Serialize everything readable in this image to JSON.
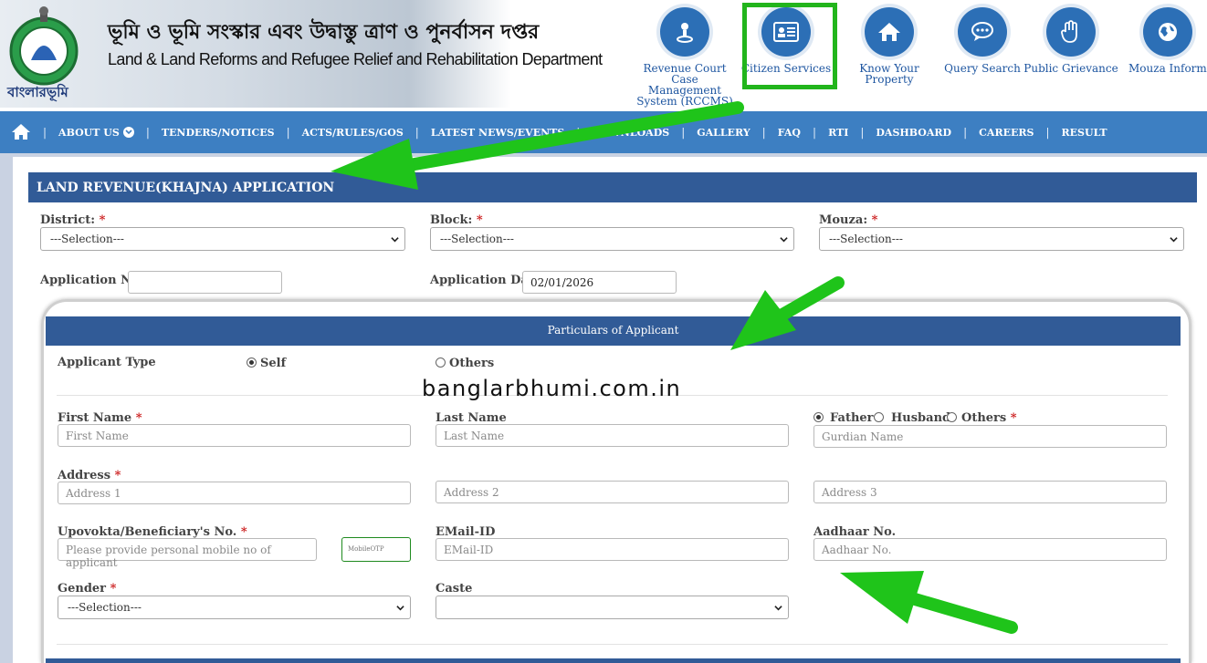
{
  "header": {
    "dept_bengali": "ভূমি ও ভূমি সংস্কার এবং উদ্বাস্তু ত্রাণ ও পুনর্বাসন দপ্তর",
    "dept_english": "Land & Land Reforms and Refugee Relief and Rehabilitation Department",
    "logo_text": "বাংলারভূমি",
    "services": [
      {
        "label": "Revenue Court Case Management System (RCCMS)",
        "icon": "person-pin-icon"
      },
      {
        "label": "Citizen Services",
        "icon": "id-card-icon"
      },
      {
        "label": "Know Your Property",
        "icon": "house-icon"
      },
      {
        "label": "Query Search",
        "icon": "chat-bubble-icon"
      },
      {
        "label": "Public Grievance",
        "icon": "hand-icon"
      },
      {
        "label": "Mouza Informati",
        "icon": "globe-icon"
      }
    ]
  },
  "nav": {
    "items": [
      "ABOUT US",
      "TENDERS/NOTICES",
      "ACTS/RULES/GOS",
      "LATEST NEWS/EVENTS",
      "DOWNLOADS",
      "GALLERY",
      "FAQ",
      "RTI",
      "DASHBOARD",
      "CAREERS",
      "RESULT"
    ]
  },
  "form": {
    "title": "LAND REVENUE(KHAJNA) APPLICATION",
    "district_label": "District:",
    "block_label": "Block:",
    "mouza_label": "Mouza:",
    "selection_placeholder": "---Selection---",
    "application_no_label": "Application No",
    "application_no_value": "",
    "application_date_label": "Application Date",
    "application_date_value": "02/01/2026",
    "required_mark": "*"
  },
  "applicant": {
    "section_title": "Particulars of Applicant",
    "type_label": "Applicant Type",
    "type_self": "Self",
    "type_others": "Others",
    "first_name_label": "First Name",
    "first_name_placeholder": "First Name",
    "last_name_label": "Last Name",
    "last_name_placeholder": "Last Name",
    "relation_father": "Father",
    "relation_husband": "Husband",
    "relation_others": "Others",
    "guardian_placeholder": "Gurdian Name",
    "address_label": "Address",
    "address1_placeholder": "Address 1",
    "address2_placeholder": "Address 2",
    "address3_placeholder": "Address 3",
    "mobile_label": "Upovokta/Beneficiary's No.",
    "mobile_placeholder": "Please provide personal mobile no of applicant",
    "otp_label": "MobileOTP",
    "email_label": "EMail-ID",
    "email_placeholder": "EMail-ID",
    "aadhaar_label": "Aadhaar No.",
    "aadhaar_placeholder": "Aadhaar No.",
    "gender_label": "Gender",
    "gender_value": "---Selection---",
    "caste_label": "Caste",
    "caste_value": ""
  },
  "watermark": "banglarbhumi.com.in",
  "colors": {
    "nav_blue": "#3d7fc2",
    "panel_header": "#315b97",
    "highlight_green": "#22b51c",
    "arrow_green": "#1fc41a"
  }
}
